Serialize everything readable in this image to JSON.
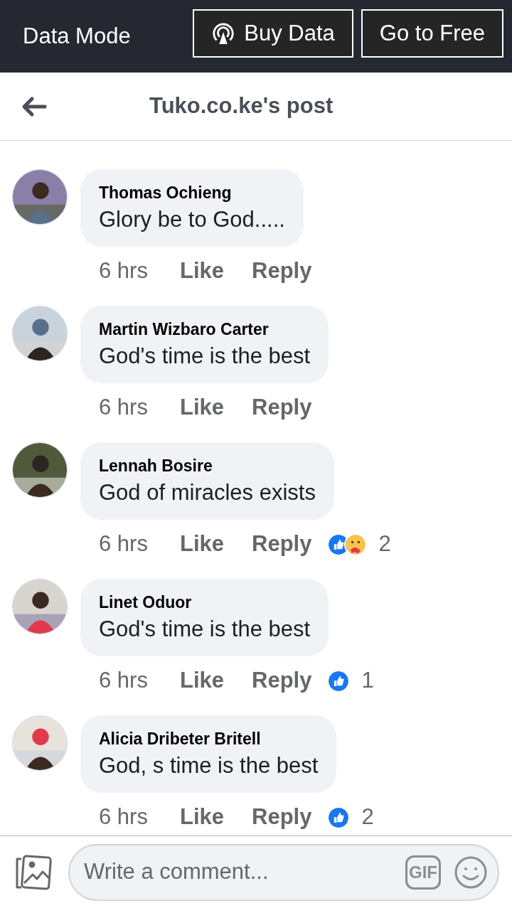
{
  "data_bar": {
    "label": "Data Mode",
    "buttons": [
      {
        "label": "Buy Data",
        "icon": true
      },
      {
        "label": "Go to Free",
        "icon": false
      }
    ]
  },
  "header": {
    "title": "Tuko.co.ke's post"
  },
  "comments": [
    {
      "author": "Thomas Ochieng",
      "text": "Glory be to God.....",
      "time": "6 hrs",
      "like": "Like",
      "reply": "Reply",
      "avatar": {
        "kind": "picture"
      }
    },
    {
      "author": "Martin Wizbaro Carter",
      "text": "God's time is the best",
      "time": "6 hrs",
      "like": "Like",
      "reply": "Reply",
      "avatar": {
        "kind": "picture"
      }
    },
    {
      "author": "Lennah Bosire",
      "text": "God of miracles exists",
      "time": "6 hrs",
      "like": "Like",
      "reply": "Reply",
      "reactions": [
        {
          "kind": "like"
        },
        {
          "kind": "care"
        }
      ],
      "count": "2",
      "avatar": {
        "kind": "picture"
      }
    },
    {
      "author": "Linet Oduor",
      "text": "God's time is the best",
      "time": "6 hrs",
      "like": "Like",
      "reply": "Reply",
      "reactions": [
        {
          "kind": "like"
        }
      ],
      "count": "1",
      "avatar": {
        "kind": "picture"
      }
    },
    {
      "author": "Alicia Dribeter Britell",
      "text": "God, s time is the best",
      "time": "6 hrs",
      "like": "Like",
      "reply": "Reply",
      "reactions": [
        {
          "kind": "like"
        }
      ],
      "count": "2",
      "avatar": {
        "kind": "picture"
      }
    }
  ],
  "composer": {
    "placeholder": "Write a comment...",
    "gif": "GIF"
  }
}
